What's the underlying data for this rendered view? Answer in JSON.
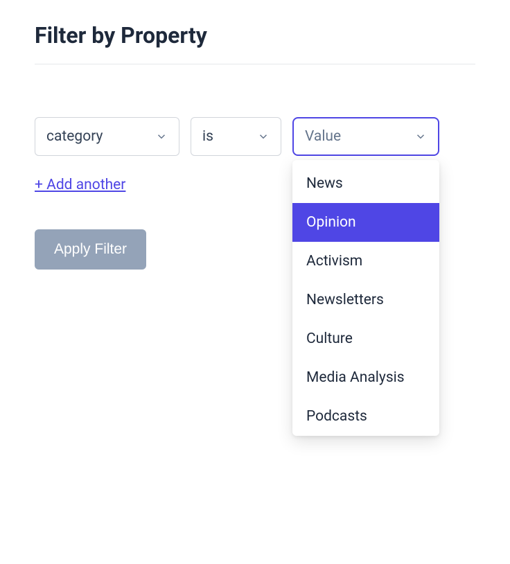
{
  "title": "Filter by Property",
  "filterRow": {
    "property": {
      "value": "category"
    },
    "operator": {
      "value": "is"
    },
    "value": {
      "placeholder": "Value"
    }
  },
  "addAnother": "+ Add another",
  "applyButton": "Apply Filter",
  "dropdown": {
    "options": [
      {
        "label": "News",
        "highlighted": false
      },
      {
        "label": "Opinion",
        "highlighted": true
      },
      {
        "label": "Activism",
        "highlighted": false
      },
      {
        "label": "Newsletters",
        "highlighted": false
      },
      {
        "label": "Culture",
        "highlighted": false
      },
      {
        "label": "Media Analysis",
        "highlighted": false
      },
      {
        "label": "Podcasts",
        "highlighted": false
      }
    ]
  }
}
